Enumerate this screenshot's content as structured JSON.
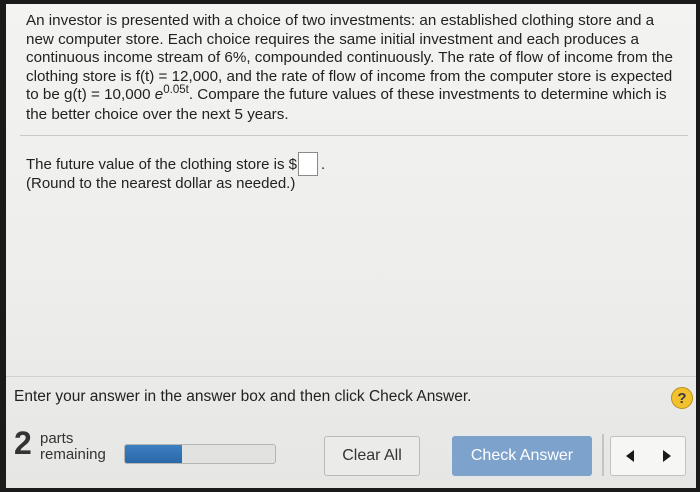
{
  "question": {
    "text_1": "An investor is presented with a choice of two investments: an established clothing store and a new computer store. Each choice requires the same initial investment and each produces a continuous income stream of 6%, compounded continuously. The rate of flow of income from the clothing store is f(t) = 12,000, and the rate of flow of income from the computer store is expected to be g(t) = 10,000",
    "e": "e",
    "exponent": "0.05t",
    "text_2": ". Compare the future values of these investments to determine which is the better choice over the next 5 years."
  },
  "answer": {
    "prompt": "The future value of the clothing store is $",
    "value": "",
    "suffix": ".",
    "note": "(Round to the nearest dollar as needed.)"
  },
  "footer": {
    "instruction": "Enter your answer in the answer box and then click Check Answer.",
    "help_symbol": "?",
    "parts_count": "2",
    "parts_label_1": "parts",
    "parts_label_2": "remaining",
    "progress_fraction": 0.38,
    "clear_label": "Clear All",
    "check_label": "Check Answer"
  },
  "icons": {
    "help": "question-mark-icon",
    "prev": "triangle-left-icon",
    "next": "triangle-right-icon"
  },
  "colors": {
    "check_button": "#7da3cc",
    "progress_fill": "#2f6fb1",
    "help_icon": "#f2c12e"
  }
}
